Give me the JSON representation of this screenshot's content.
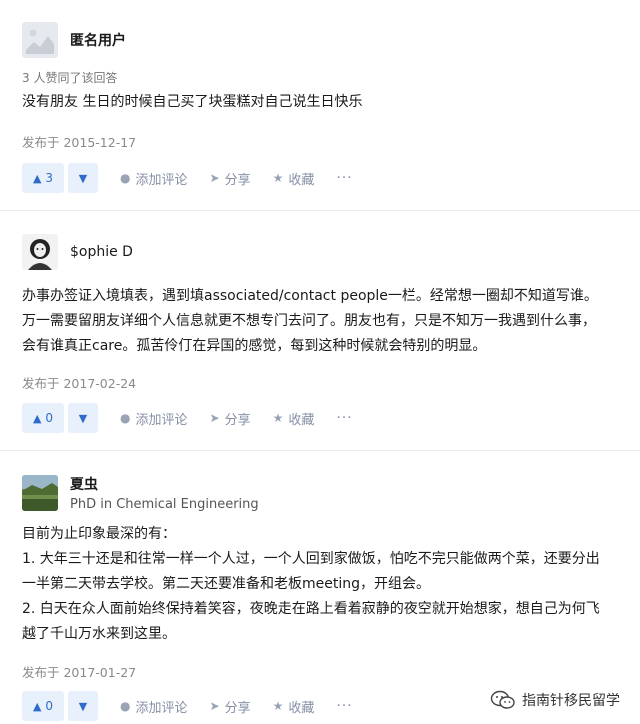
{
  "answers": [
    {
      "author": "匿名用户",
      "voters": "3 人赞同了该回答",
      "content": "没有朋友 生日的时候自己买了块蛋糕对自己说生日快乐",
      "date": "发布于 2015-12-17",
      "upvotes": "3"
    },
    {
      "author": "$ophie D",
      "content": "办事办签证入境填表，遇到填associated/contact people一栏。经常想一圈却不知道写谁。万一需要留朋友详细个人信息就更不想专门去问了。朋友也有，只是不知万一我遇到什么事，会有谁真正care。孤苦伶仃在异国的感觉，每到这种时候就会特别的明显。",
      "date": "发布于 2017-02-24",
      "upvotes": "0"
    },
    {
      "author": "夏虫",
      "bio": "PhD in Chemical Engineering",
      "content_lines": [
        "目前为止印象最深的有：",
        "1. 大年三十还是和往常一样一个人过，一个人回到家做饭，怕吃不完只能做两个菜，还要分出一半第二天带去学校。第二天还要准备和老板meeting，开组会。",
        "2. 白天在众人面前始终保持着笑容，夜晚走在路上看着寂静的夜空就开始想家，想自己为何飞越了千山万水来到这里。"
      ],
      "date": "发布于 2017-01-27",
      "upvotes": "0"
    }
  ],
  "actions": {
    "comment": "添加评论",
    "share": "分享",
    "favorite": "收藏",
    "more": "···"
  },
  "watermark": "指南针移民留学",
  "colors": {
    "accent": "#2f6cc9",
    "vote_bg": "#e8f0fb",
    "muted": "#8590a6"
  }
}
